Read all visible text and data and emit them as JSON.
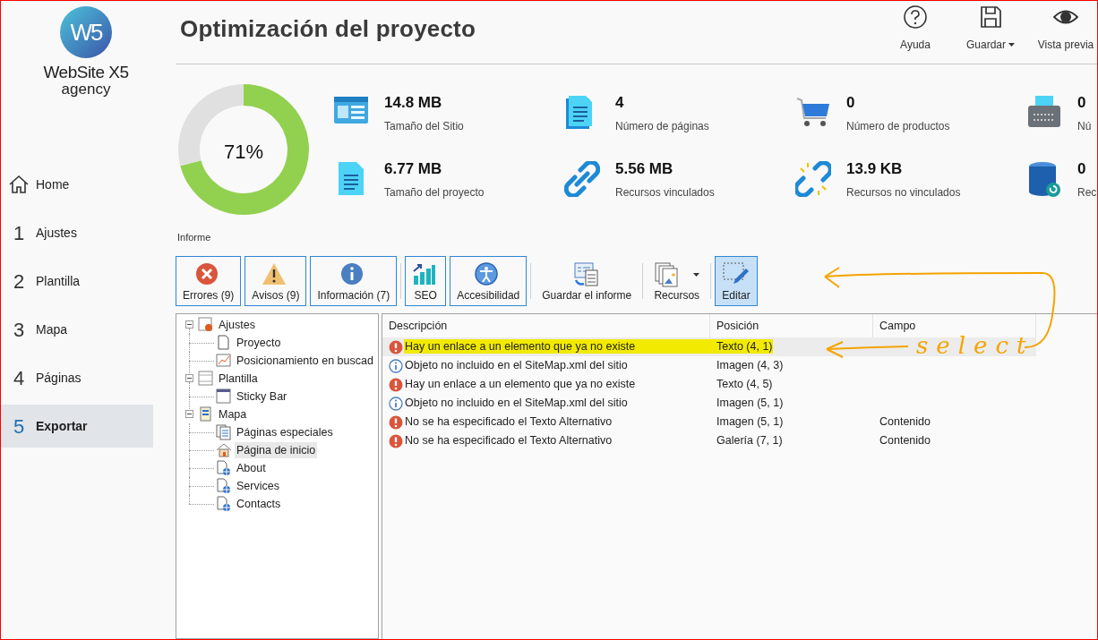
{
  "logo": {
    "mark": "W5",
    "name": "WebSite X5",
    "sub": "agency"
  },
  "sidebar": {
    "items": [
      {
        "kind": "home",
        "label": "Home",
        "selected": false
      },
      {
        "number": "1",
        "label": "Ajustes",
        "selected": false
      },
      {
        "number": "2",
        "label": "Plantilla",
        "selected": false
      },
      {
        "number": "3",
        "label": "Mapa",
        "selected": false
      },
      {
        "number": "4",
        "label": "Páginas",
        "selected": false
      },
      {
        "number": "5",
        "label": "Exportar",
        "selected": true
      }
    ]
  },
  "title": "Optimización del proyecto",
  "header_buttons": [
    {
      "label": "Ayuda",
      "dropdown": false
    },
    {
      "label": "Guardar",
      "dropdown": true
    },
    {
      "label": "Vista previa",
      "dropdown": false
    }
  ],
  "score": {
    "text": "71%",
    "chart_data": {
      "type": "donut",
      "values": [
        71,
        29
      ]
    }
  },
  "stats": [
    {
      "value": "14.8 MB",
      "label": "Tamaño del Sitio"
    },
    {
      "value": "4",
      "label": "Número de páginas"
    },
    {
      "value": "0",
      "label": "Número de productos"
    },
    {
      "value": "0",
      "label": "Nú"
    },
    {
      "value": "6.77 MB",
      "label": "Tamaño del proyecto"
    },
    {
      "value": "5.56 MB",
      "label": "Recursos vinculados"
    },
    {
      "value": "13.9 KB",
      "label": "Recursos no vinculados"
    },
    {
      "value": "0",
      "label": "Rec"
    }
  ],
  "report_label": "Informe",
  "toolbar": {
    "groups": [
      [
        {
          "kind": "toggle",
          "label": "Errores (9)",
          "on": true
        },
        {
          "kind": "toggle",
          "label": "Avisos (9)",
          "on": true
        },
        {
          "kind": "toggle",
          "label": "Información (7)",
          "on": true
        }
      ],
      [
        {
          "kind": "toggle",
          "label": "SEO",
          "on": true
        },
        {
          "kind": "toggle",
          "label": "Accesibilidad",
          "on": true
        }
      ],
      [
        {
          "kind": "action",
          "label": "Guardar el informe",
          "on": false
        }
      ],
      [
        {
          "kind": "action",
          "label": "Recursos",
          "on": false,
          "dropdown": true
        }
      ],
      [
        {
          "kind": "action",
          "label": "Editar",
          "on": true
        }
      ]
    ]
  },
  "tree": [
    {
      "label": "Ajustes",
      "expanded": true,
      "selected": false,
      "children": [
        {
          "label": "Proyecto",
          "selected": false
        },
        {
          "label": "Posicionamiento en buscad",
          "selected": false
        }
      ]
    },
    {
      "label": "Plantilla",
      "expanded": true,
      "selected": false,
      "children": [
        {
          "label": "Sticky Bar",
          "selected": false
        }
      ]
    },
    {
      "label": "Mapa",
      "expanded": true,
      "selected": false,
      "children": [
        {
          "kind": "special",
          "label": "Páginas especiales",
          "selected": false
        },
        {
          "kind": "home",
          "label": "Página de inicio",
          "selected": true
        },
        {
          "kind": "web",
          "label": "About",
          "selected": false
        },
        {
          "kind": "web",
          "label": "Services",
          "selected": false
        },
        {
          "kind": "web",
          "label": "Contacts",
          "selected": false
        }
      ]
    }
  ],
  "table": {
    "columns": [
      "Descripción",
      "Posición",
      "Campo"
    ],
    "rows": [
      {
        "kind": "error",
        "cells": [
          "Hay un enlace a un elemento que ya no existe",
          "Texto (4, 1)",
          null
        ],
        "selected": true,
        "highlighted": true
      },
      {
        "kind": "info",
        "cells": [
          "Objeto no incluido en el SiteMap.xml del sitio",
          "Imagen (4, 3)",
          null
        ],
        "selected": false,
        "highlighted": false
      },
      {
        "kind": "error",
        "cells": [
          "Hay un enlace a un elemento que ya no existe",
          "Texto (4, 5)",
          null
        ],
        "selected": false,
        "highlighted": false
      },
      {
        "kind": "info",
        "cells": [
          "Objeto no incluido en el SiteMap.xml del sitio",
          "Imagen (5, 1)",
          null
        ],
        "selected": false,
        "highlighted": false
      },
      {
        "kind": "error",
        "cells": [
          "No se ha especificado el Texto Alternativo",
          "Imagen (5, 1)",
          "Contenido"
        ],
        "selected": false,
        "highlighted": false
      },
      {
        "kind": "error",
        "cells": [
          "No se ha especificado el Texto Alternativo",
          "Galería (7, 1)",
          "Contenido"
        ],
        "selected": false,
        "highlighted": false
      }
    ]
  },
  "annotation": {
    "note": "select"
  }
}
